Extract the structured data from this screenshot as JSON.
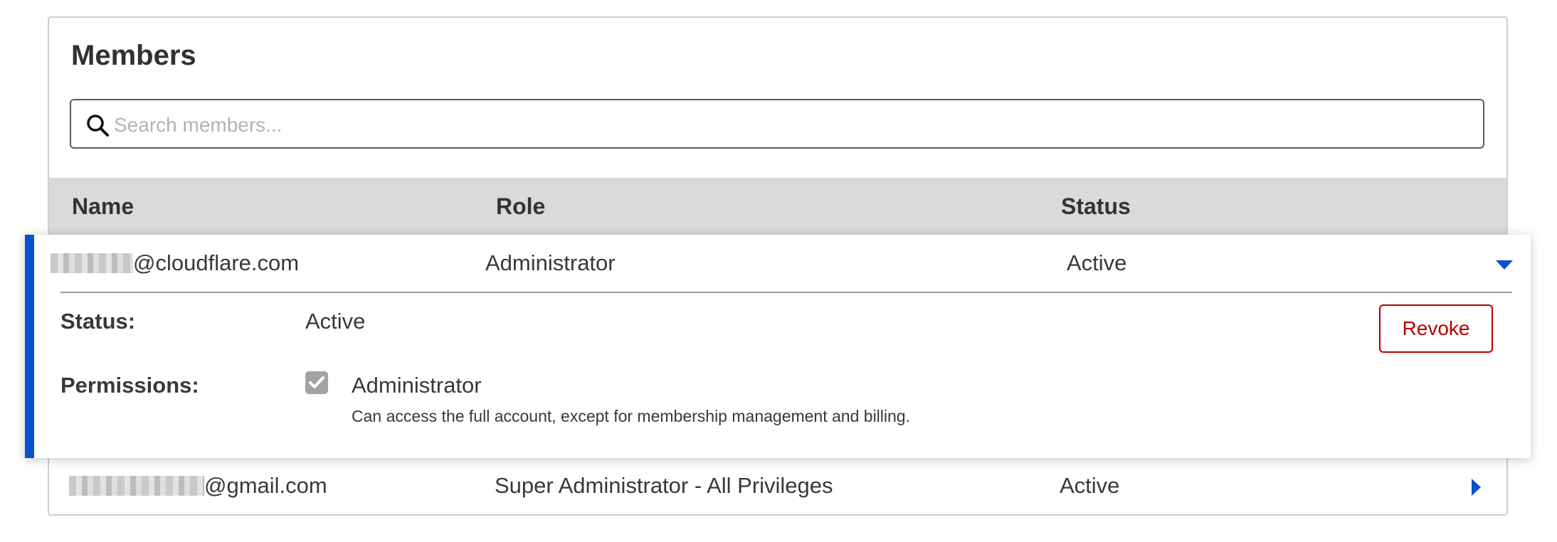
{
  "panel": {
    "title": "Members"
  },
  "search": {
    "placeholder": "Search members...",
    "icon": "search-icon"
  },
  "table": {
    "columns": [
      "Name",
      "Role",
      "Status"
    ],
    "rows": [
      {
        "email_suffix": "@cloudflare.com",
        "role": "Administrator",
        "status": "Active",
        "expanded": true,
        "details": {
          "status_label": "Status:",
          "status_value": "Active",
          "permissions_label": "Permissions:",
          "permission_name": "Administrator",
          "permission_checked": true,
          "permission_description": "Can access the full account, except for membership management and billing.",
          "revoke_label": "Revoke"
        }
      },
      {
        "email_suffix": "@gmail.com",
        "role": "Super Administrator - All Privileges",
        "status": "Active",
        "expanded": false
      }
    ]
  },
  "colors": {
    "accent": "#0a51d1",
    "danger": "#b80000",
    "header_bg": "#dadada",
    "checkbox": "#a3a3a3"
  }
}
